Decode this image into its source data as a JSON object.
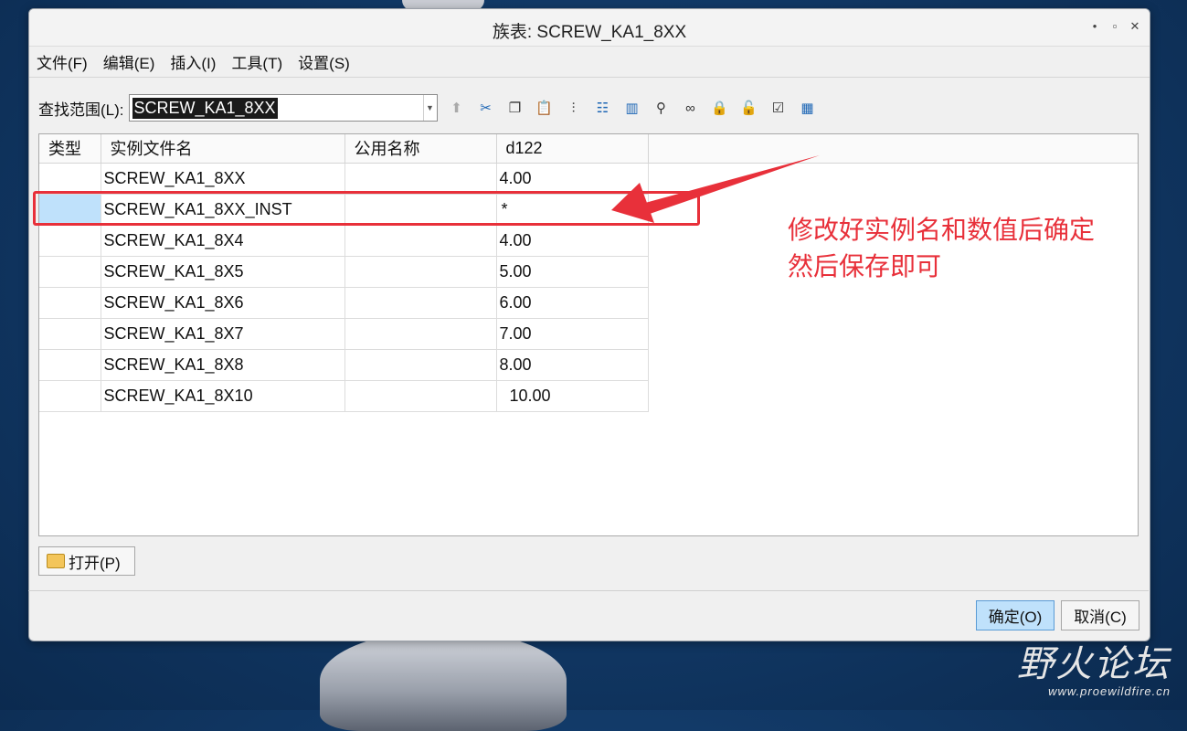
{
  "window": {
    "title": "族表: SCREW_KA1_8XX",
    "controls": [
      "minimize-icon",
      "maximize-icon",
      "close-icon"
    ]
  },
  "menu": [
    {
      "label": "文件(F)"
    },
    {
      "label": "编辑(E)"
    },
    {
      "label": "插入(I)"
    },
    {
      "label": "工具(T)"
    },
    {
      "label": "设置(S)"
    }
  ],
  "lookin": {
    "label": "查找范围(L):",
    "value": "SCREW_KA1_8XX"
  },
  "toolbar_icons": [
    "up-level-icon",
    "cut-icon",
    "copy-icon",
    "paste-icon",
    "insert-column-icon",
    "tree-icon",
    "column-icon",
    "find-icon",
    "preview-icon",
    "lock-icon",
    "unlock-icon",
    "verify-icon",
    "table-icon"
  ],
  "table": {
    "headers": [
      "类型",
      "实例文件名",
      "公用名称",
      "d122"
    ],
    "rows": [
      {
        "type": "",
        "name": "SCREW_KA1_8XX",
        "common": "",
        "d122": "4.00"
      },
      {
        "type": "",
        "name": "SCREW_KA1_8XX_INST",
        "common": "",
        "d122": "*"
      },
      {
        "type": "",
        "name": "SCREW_KA1_8X4",
        "common": "",
        "d122": "4.00"
      },
      {
        "type": "",
        "name": "SCREW_KA1_8X5",
        "common": "",
        "d122": "5.00"
      },
      {
        "type": "",
        "name": "SCREW_KA1_8X6",
        "common": "",
        "d122": "6.00"
      },
      {
        "type": "",
        "name": "SCREW_KA1_8X7",
        "common": "",
        "d122": "7.00"
      },
      {
        "type": "",
        "name": "SCREW_KA1_8X8",
        "common": "",
        "d122": "8.00"
      },
      {
        "type": "",
        "name": "SCREW_KA1_8X10",
        "common": "",
        "d122": "10.00"
      }
    ],
    "selected_row": 1
  },
  "annotation": {
    "line1": "修改好实例名和数值后确定",
    "line2": "然后保存即可",
    "color": "#e8303a"
  },
  "buttons": {
    "open": "打开(P)",
    "ok": "确定(O)",
    "cancel": "取消(C)"
  },
  "watermark": {
    "main": "野火论坛",
    "sub": "www.proewildfire.cn"
  }
}
